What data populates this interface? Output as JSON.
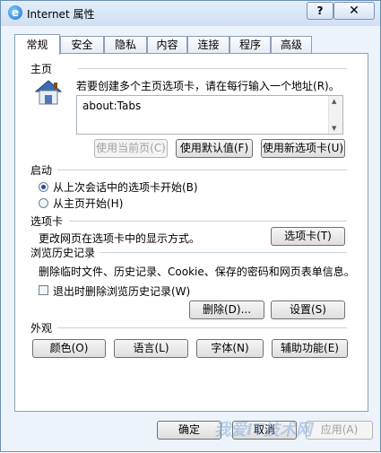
{
  "window": {
    "title": "Internet 属性",
    "help_label": "?",
    "close_label": "✕"
  },
  "tabs": [
    {
      "label": "常规"
    },
    {
      "label": "安全"
    },
    {
      "label": "隐私"
    },
    {
      "label": "内容"
    },
    {
      "label": "连接"
    },
    {
      "label": "程序"
    },
    {
      "label": "高级"
    }
  ],
  "home": {
    "section_title": "主页",
    "description": "若要创建多个主页选项卡，请在每行输入一个地址",
    "description_key": "(R)。",
    "textarea_value": "about:Tabs",
    "btn_use_current": "使用当前页(C)",
    "btn_use_default": "使用默认值(F)",
    "btn_use_new_tab": "使用新选项卡(U)"
  },
  "startup": {
    "section_title": "启动",
    "option_last_session": "从上次会话中的选项卡开始(B)",
    "option_home": "从主页开始(H)"
  },
  "tabs_section": {
    "section_title": "选项卡",
    "description": "更改网页在选项卡中的显示方式。",
    "btn_tabs": "选项卡(T)"
  },
  "history": {
    "section_title": "浏览历史记录",
    "description": "删除临时文件、历史记录、Cookie、保存的密码和网页表单信息。",
    "checkbox_label": "退出时删除浏览历史记录(W)",
    "btn_delete": "删除(D)...",
    "btn_settings": "设置(S)"
  },
  "appearance": {
    "section_title": "外观",
    "btn_colors": "颜色(O)",
    "btn_languages": "语言(L)",
    "btn_fonts": "字体(N)",
    "btn_accessibility": "辅助功能(E)"
  },
  "footer": {
    "btn_ok": "确定",
    "btn_cancel": "取消",
    "btn_apply": "应用(A)"
  },
  "watermark": "我爱IT技术网"
}
